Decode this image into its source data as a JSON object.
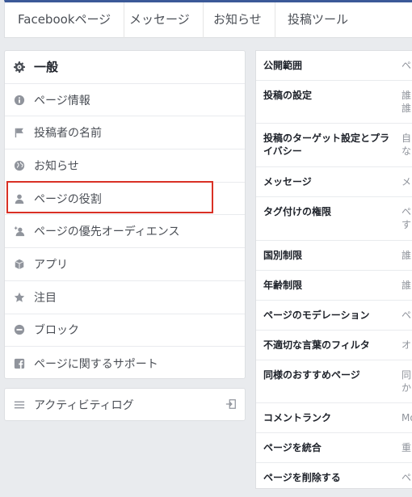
{
  "topnav": {
    "tabs": [
      "Facebookページ",
      "メッセージ",
      "お知らせ",
      "投稿ツール"
    ]
  },
  "sidebar": {
    "items": [
      {
        "label": "一般",
        "icon": "gear-icon"
      },
      {
        "label": "ページ情報",
        "icon": "info-icon"
      },
      {
        "label": "投稿者の名前",
        "icon": "flag-icon"
      },
      {
        "label": "お知らせ",
        "icon": "globe-icon"
      },
      {
        "label": "ページの役割",
        "icon": "person-icon"
      },
      {
        "label": "ページの優先オーディエンス",
        "icon": "person-add-icon"
      },
      {
        "label": "アプリ",
        "icon": "cube-icon"
      },
      {
        "label": "注目",
        "icon": "star-icon"
      },
      {
        "label": "ブロック",
        "icon": "block-icon"
      },
      {
        "label": "ページに関するサポート",
        "icon": "facebook-icon"
      }
    ],
    "activity_log": {
      "label": "アクティビティログ",
      "icon": "list-icon"
    }
  },
  "settings": {
    "rows": [
      {
        "label": "公開範囲",
        "value": "ペ"
      },
      {
        "label": "投稿の設定",
        "value": "誰\n誰"
      },
      {
        "label": "投稿のターゲット設定とプライバシー",
        "value": "自\nな"
      },
      {
        "label": "メッセージ",
        "value": "メ"
      },
      {
        "label": "タグ付けの権限",
        "value": "ペ\nす"
      },
      {
        "label": "国別制限",
        "value": "誰"
      },
      {
        "label": "年齢制限",
        "value": "誰"
      },
      {
        "label": "ページのモデレーション",
        "value": "ペ"
      },
      {
        "label": "不適切な言葉のフィルタ",
        "value": "オ"
      },
      {
        "label": "同様のおすすめページ",
        "value": "同\nか"
      },
      {
        "label": "コメントランク",
        "value": "Mo"
      },
      {
        "label": "ページを統合",
        "value": "重"
      },
      {
        "label": "ページを削除する",
        "value": "ペ"
      }
    ]
  }
}
